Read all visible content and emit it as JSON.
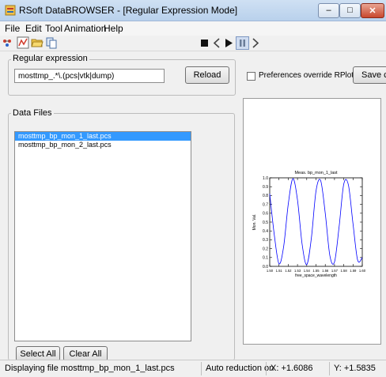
{
  "window": {
    "title": "RSoft DataBROWSER - [Regular Expression Mode]",
    "minimize_glyph": "–",
    "maximize_glyph": "□",
    "close_glyph": "✕"
  },
  "menu": [
    "File",
    "Edit",
    "Tool",
    "Animation",
    "Help"
  ],
  "toolbar": {
    "icons": [
      "network-icon",
      "chart-icon",
      "folder-open-icon",
      "copy-icon"
    ],
    "play_controls": [
      "stop",
      "previous",
      "play",
      "pause",
      "next"
    ]
  },
  "regex": {
    "group_label": "Regular expression",
    "value": "mosttmp_.*\\.(pcs|vtk|dump)",
    "reload_label": "Reload"
  },
  "preferences": {
    "checkbox_label": "Preferences override RPlot files",
    "checked": false,
    "save_label": "Save cu"
  },
  "data_files": {
    "group_label": "Data Files",
    "items": [
      {
        "name": "mosttmp_bp_mon_1_last.pcs",
        "selected": true
      },
      {
        "name": "mosttmp_bp_mon_2_last.pcs",
        "selected": false
      }
    ],
    "select_all_label": "Select All",
    "clear_all_label": "Clear All"
  },
  "status": {
    "message": "Displaying file mosttmp_bp_mon_1_last.pcs",
    "reduction": "Auto reduction on",
    "x": "X: +1.6086",
    "y": "Y: +1.5835"
  },
  "colors": {
    "selection": "#3399ff",
    "plot_line": "#0000ff",
    "title_bar": "#c7dbf0",
    "close_button": "#c8472d"
  },
  "chart_data": {
    "type": "line",
    "title": "Meas. bp_mon_1_last",
    "xlabel": "free_space_wavelength",
    "ylabel": "Mon. Val.",
    "xlim": [
      1.5,
      1.6
    ],
    "ylim": [
      0.0,
      1.0
    ],
    "x_ticks": [
      "1.50",
      "1.51",
      "1.52",
      "1.53",
      "1.54",
      "1.55",
      "1.56",
      "1.57",
      "1.58",
      "1.59",
      "1.60"
    ],
    "y_ticks": [
      "0.0",
      "0.1",
      "0.2",
      "0.3",
      "0.4",
      "0.5",
      "0.6",
      "0.7",
      "0.8",
      "0.9",
      "1.0"
    ],
    "series": [
      {
        "x": [
          1.5,
          1.505,
          1.51,
          1.515,
          1.52,
          1.525,
          1.53,
          1.535,
          1.54,
          1.545,
          1.55,
          1.555,
          1.56,
          1.565,
          1.57,
          1.575,
          1.58,
          1.585,
          1.59,
          1.595,
          1.6
        ],
        "y": [
          0.82,
          0.35,
          0.03,
          0.22,
          0.7,
          0.99,
          0.75,
          0.25,
          0.02,
          0.32,
          0.85,
          0.97,
          0.6,
          0.12,
          0.05,
          0.45,
          0.93,
          0.92,
          0.48,
          0.07,
          0.1
        ]
      }
    ]
  }
}
